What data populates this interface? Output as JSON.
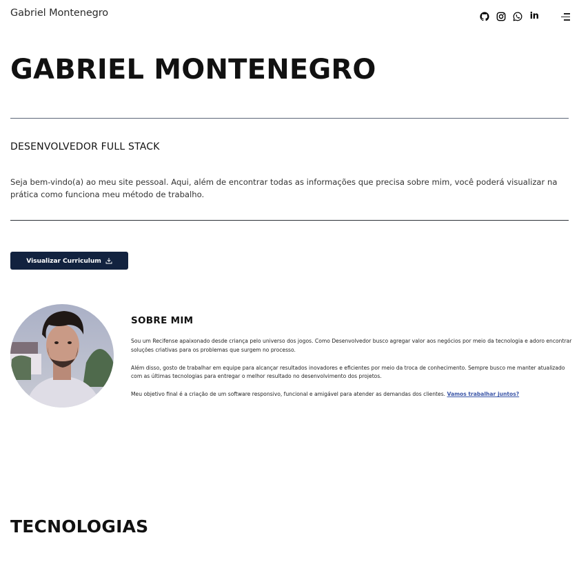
{
  "header": {
    "brand": "Gabriel Montenegro",
    "socials": [
      {
        "name": "github-icon"
      },
      {
        "name": "instagram-icon"
      },
      {
        "name": "whatsapp-icon"
      },
      {
        "name": "linkedin-icon",
        "label": "in"
      }
    ],
    "menu_icon": "hamburger-menu-icon"
  },
  "hero": {
    "title": "GABRIEL MONTENEGRO",
    "role": "DESENVOLVEDOR FULL STACK",
    "intro": "Seja bem-vindo(a) ao meu site pessoal. Aqui, além de encontrar todas as informações que precisa sobre mim, você poderá visualizar na prática como funciona meu método de trabalho.",
    "cv_button": "Visualizar Curriculum"
  },
  "about": {
    "title": "SOBRE MIM",
    "p1": "Sou um Recifense apaixonado desde criança pelo universo dos jogos. Como Desenvolvedor busco agregar valor aos negócios por meio da tecnologia e adoro encontrar soluções criativas para os problemas que surgem no processo.",
    "p2": "Além disso, gosto de trabalhar em equipe para alcançar resultados inovadores e eficientes por meio da troca de conhecimento. Sempre busco me manter atualizado com as últimas tecnologias para entregar o melhor resultado no desenvolvimento dos projetos.",
    "p3": "Meu objetivo final é a criação de um software responsivo, funcional e amigável para atender as demandas dos clientes.",
    "link": "Vamos trabalhar juntos?"
  },
  "tech": {
    "title": "TECNOLOGIAS"
  },
  "colors": {
    "button_bg": "#12223f",
    "link": "#3b56a8",
    "rule": "#5a6577"
  }
}
